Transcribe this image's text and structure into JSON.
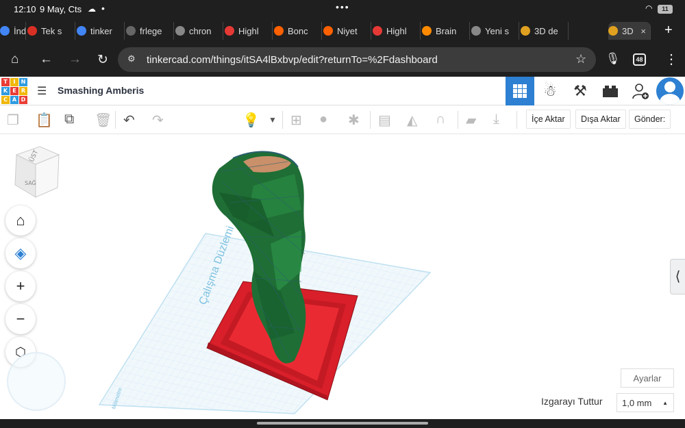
{
  "status": {
    "time": "12:10",
    "date": "9 May, Cts",
    "battery": "11"
  },
  "tabs": [
    {
      "label": "İndiri",
      "icon": "chrome-icon",
      "color": "#4285f4"
    },
    {
      "label": "Tek s",
      "icon": "gmail-icon",
      "color": "#d93025"
    },
    {
      "label": "tinker",
      "icon": "google-icon",
      "color": "#4285f4"
    },
    {
      "label": "frlege",
      "icon": "chrome-icon",
      "color": "#666666"
    },
    {
      "label": "chron",
      "icon": "chrome-icon",
      "color": "#888888"
    },
    {
      "label": "Highl",
      "icon": "site-icon",
      "color": "#e53935"
    },
    {
      "label": "Bonc",
      "icon": "hb-icon",
      "color": "#ff6000"
    },
    {
      "label": "Niyet",
      "icon": "hb-icon",
      "color": "#ff6000"
    },
    {
      "label": "Highl",
      "icon": "site-icon",
      "color": "#e53935"
    },
    {
      "label": "Brain",
      "icon": "brain-icon",
      "color": "#ff8a00"
    },
    {
      "label": "Yeni s",
      "icon": "chrome-icon",
      "color": "#888888"
    },
    {
      "label": "3D de",
      "icon": "tinkercad-icon",
      "color": "#e0a020"
    },
    {
      "label": "3D",
      "icon": "tinkercad-icon",
      "color": "#e0a020"
    }
  ],
  "address": {
    "url": "tinkercad.com/things/itSA4lBxbvp/edit?returnTo=%2Fdashboard",
    "tab_count": "48"
  },
  "logo": [
    "T",
    "I",
    "N",
    "K",
    "E",
    "R",
    "C",
    "A",
    "D"
  ],
  "logo_colors": [
    "#e93d36",
    "#f0b80a",
    "#2f9be0",
    "#2f9be0",
    "#e93d36",
    "#f0b80a",
    "#f0b80a",
    "#2f9be0",
    "#e93d36"
  ],
  "project": {
    "title": "Smashing Amberis"
  },
  "toolbar": {
    "import_label": "İçe Aktar",
    "export_label": "Dışa Aktar",
    "send_label": "Gönder:"
  },
  "viewcube": {
    "top_label": "ÜST",
    "side_label": "SAĞ"
  },
  "workplane": {
    "label": "Çalışma Düzlemi",
    "unit_label": "Milimetre"
  },
  "settings": {
    "settings_label": "Ayarlar",
    "snap_label": "Izgarayı Tuttur",
    "snap_value": "1,0 mm"
  },
  "colors": {
    "accent": "#2d80d2",
    "shape_green": "#1e6e34",
    "shape_red": "#e8252e",
    "grid_blue": "#cfe6f3"
  }
}
